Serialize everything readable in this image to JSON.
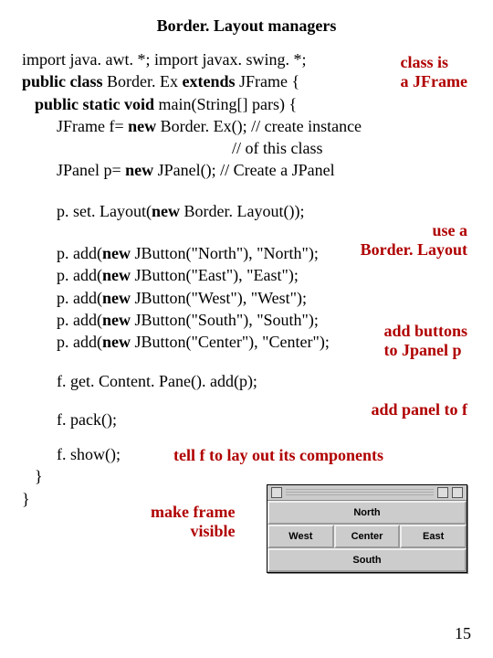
{
  "title": "Border. Layout managers",
  "code": {
    "l1a": "import java. awt. *; import javax. swing. *;",
    "l2a": "public class ",
    "l2b": "Border. Ex ",
    "l2c": "extends ",
    "l2d": "JFrame {",
    "l3a": "public static void ",
    "l3b": "main(String[] pars) {",
    "l4a": "JFrame f= ",
    "l4b": "new ",
    "l4c": "Border. Ex();  // create instance",
    "l5": "// of this class",
    "l6a": "JPanel p= ",
    "l6b": "new ",
    "l6c": "JPanel();       // Create a JPanel",
    "l7a": "p. set. Layout(",
    "l7b": "new ",
    "l7c": "Border. Layout());",
    "l8a": "p. add(",
    "l8b": "new ",
    "l8c": "JButton(\"North\"), \"North\");",
    "l9a": "p. add(",
    "l9b": "new ",
    "l9c": "JButton(\"East\"), \"East\");",
    "l10a": "p. add(",
    "l10b": "new ",
    "l10c": "JButton(\"West\"), \"West\");",
    "l11a": "p. add(",
    "l11b": "new ",
    "l11c": "JButton(\"South\"), \"South\");",
    "l12a": "p. add(",
    "l12b": "new ",
    "l12c": "JButton(\"Center\"), \"Center\");",
    "l13": "f. get. Content. Pane(). add(p);",
    "l14": "f. pack();",
    "l15": "f. show();",
    "l16": "}",
    "l17": "}"
  },
  "anno": {
    "classis1": "class is",
    "classis2": "a JFrame",
    "usea1": "use a",
    "usea2": "Border. Layout",
    "addb1": "add buttons",
    "addb2": "to Jpanel p",
    "addpanel": "add panel to f",
    "tellf": "tell f to lay out its components",
    "makeframe1": "make frame",
    "makeframe2": "visible"
  },
  "gui": {
    "north": "North",
    "west": "West",
    "center": "Center",
    "east": "East",
    "south": "South"
  },
  "pagenum": "15"
}
